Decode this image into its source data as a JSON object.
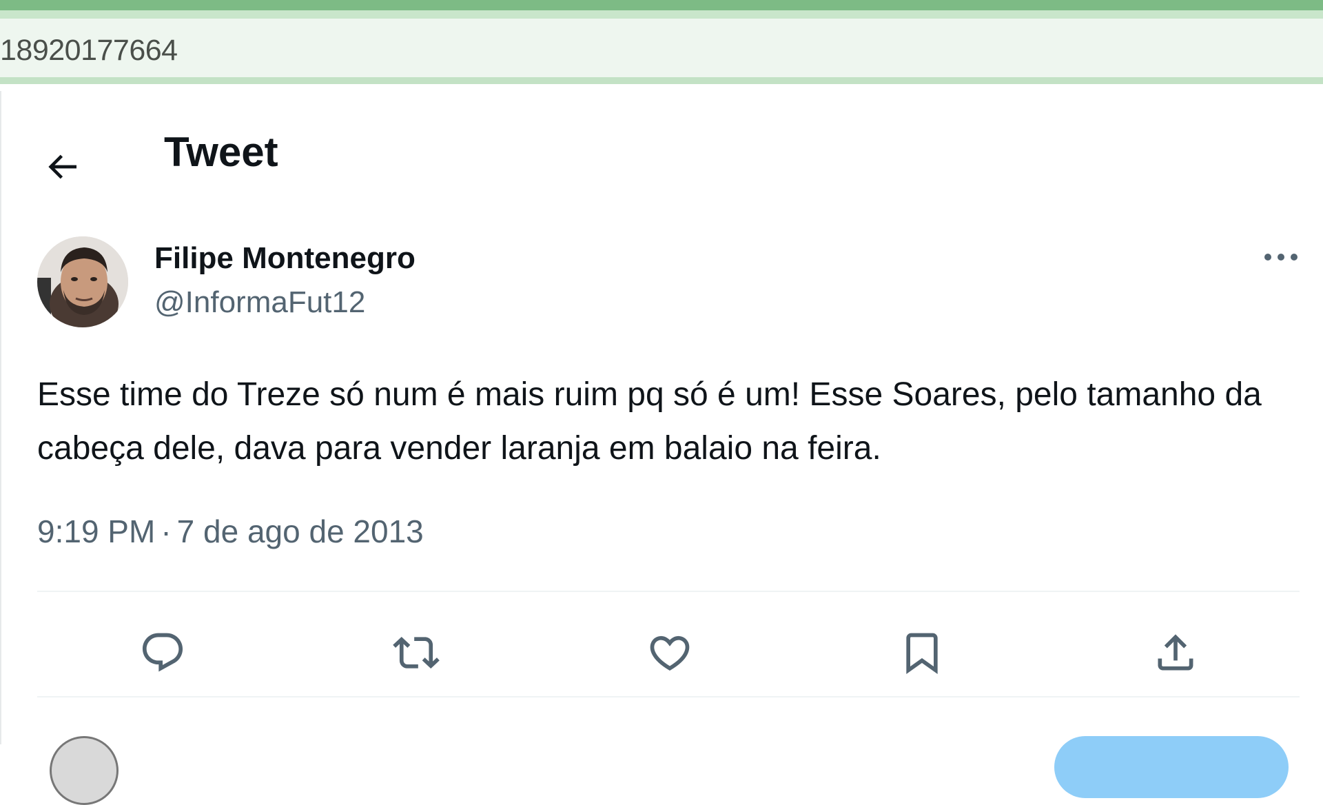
{
  "browser": {
    "url_fragment": "18920177664"
  },
  "header": {
    "back_icon": "arrow-left-icon",
    "title": "Tweet"
  },
  "tweet": {
    "author_name": "Filipe Montenegro",
    "author_handle": "@InformaFut12",
    "more_icon": "more-dots-icon",
    "text": "Esse time do Treze só num é mais ruim pq só é um! Esse Soares, pelo tamanho da cabeça dele, dava para vender laranja em balaio na feira.",
    "time": "9:19 PM",
    "separator": "·",
    "date": "7 de ago de 2013"
  },
  "actions": [
    {
      "name": "reply",
      "icon": "reply-icon"
    },
    {
      "name": "retweet",
      "icon": "retweet-icon"
    },
    {
      "name": "like",
      "icon": "heart-icon"
    },
    {
      "name": "bookmark",
      "icon": "bookmark-icon"
    },
    {
      "name": "share",
      "icon": "share-icon"
    }
  ],
  "colors": {
    "text_primary": "#0f1419",
    "text_secondary": "#536471",
    "divider": "#eff3f4",
    "browser_accent": "#7dbb85",
    "reply_button": "#8ecdf8"
  }
}
